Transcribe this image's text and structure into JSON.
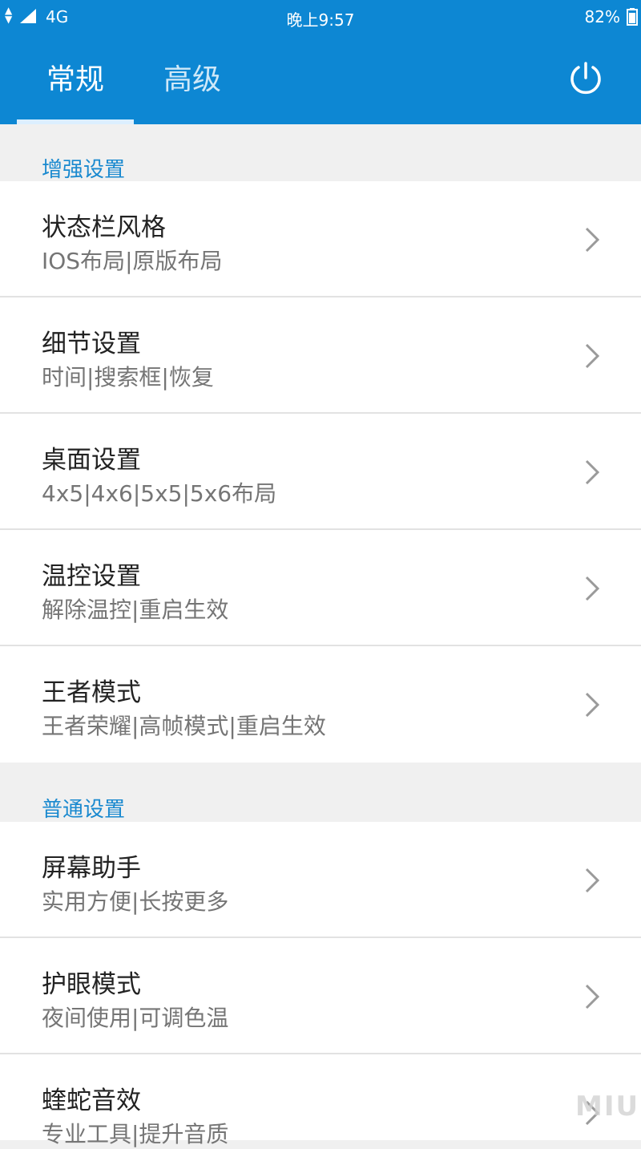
{
  "status_bar": {
    "network": "4G",
    "time": "晚上9:57",
    "battery": "82%"
  },
  "tabs": [
    {
      "label": "常规",
      "active": true
    },
    {
      "label": "高级",
      "active": false
    }
  ],
  "header_actions": {
    "power_icon": "power-icon"
  },
  "sections": [
    {
      "title": "增强设置",
      "items": [
        {
          "title": "状态栏风格",
          "subtitle": "IOS布局|原版布局"
        },
        {
          "title": "细节设置",
          "subtitle": "时间|搜索框|恢复"
        },
        {
          "title": "桌面设置",
          "subtitle": "4x5|4x6|5x5|5x6布局"
        },
        {
          "title": "温控设置",
          "subtitle": "解除温控|重启生效"
        },
        {
          "title": "王者模式",
          "subtitle": "王者荣耀|高帧模式|重启生效"
        }
      ]
    },
    {
      "title": "普通设置",
      "items": [
        {
          "title": "屏幕助手",
          "subtitle": "实用方便|长按更多"
        },
        {
          "title": "护眼模式",
          "subtitle": "夜间使用|可调色温"
        },
        {
          "title": "蝰蛇音效",
          "subtitle": "专业工具|提升音质"
        }
      ]
    }
  ],
  "watermark": "MIUI",
  "colors": {
    "header": "#0d87d3",
    "section_title": "#1989cf",
    "background": "#f0f0f0"
  }
}
